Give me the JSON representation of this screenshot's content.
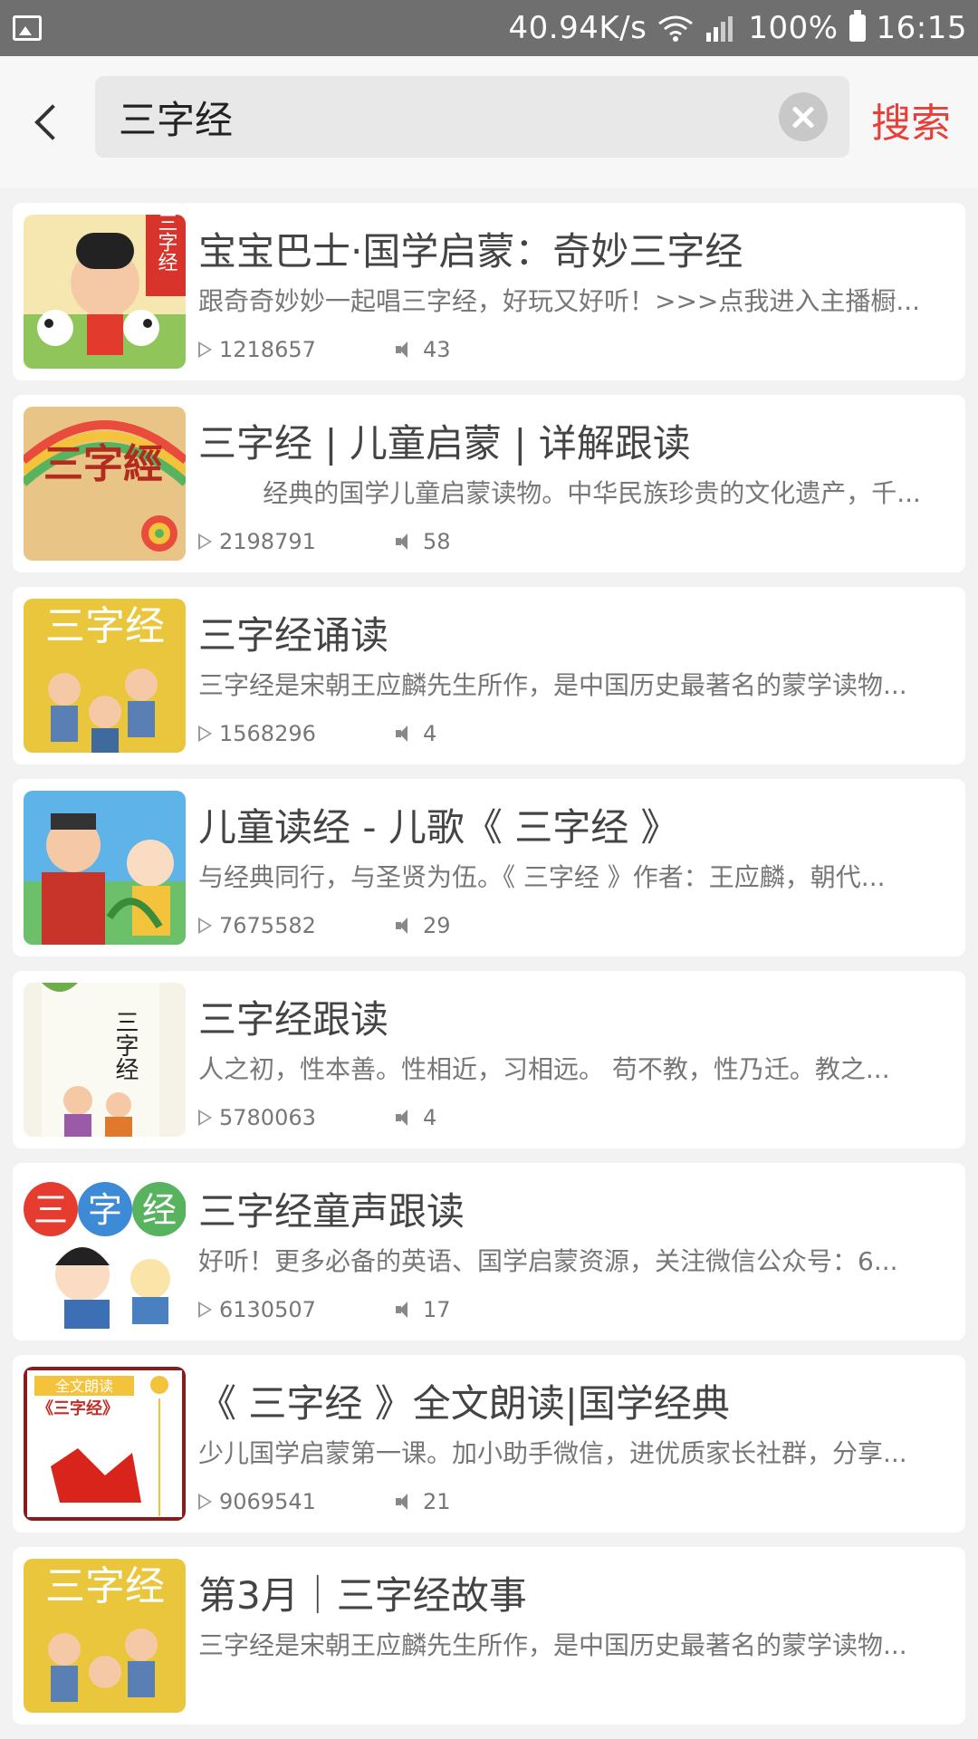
{
  "statusbar": {
    "speed": "40.94K/s",
    "network": "4G",
    "battery": "100%",
    "time": "16:15"
  },
  "header": {
    "query": "三字经",
    "search_label": "搜索"
  },
  "results": [
    {
      "title": "宝宝巴士·国学启蒙：奇妙三字经",
      "desc": "跟奇奇妙妙一起唱三字经，好玩又好听！>>>点我进入主播橱...",
      "plays": "1218657",
      "episodes": "43",
      "thumb_color": "#f7c85e"
    },
    {
      "title": "三字经 | 儿童启蒙 | 详解跟读",
      "desc": "        经典的国学儿童启蒙读物。中华民族珍贵的文化遗产，千...",
      "plays": "2198791",
      "episodes": "58",
      "thumb_color": "#e3b26a"
    },
    {
      "title": "三字经诵读",
      "desc": "三字经是宋朝王应麟先生所作，是中国历史最著名的蒙学读物...",
      "plays": "1568296",
      "episodes": "4",
      "thumb_color": "#e9c63c"
    },
    {
      "title": "儿童读经 - 儿歌《 三字经 》",
      "desc": "与经典同行，与圣贤为伍。《 三字经 》作者：王应麟，朝代...",
      "plays": "7675582",
      "episodes": "29",
      "thumb_color": "#5eb4e8"
    },
    {
      "title": "三字经跟读",
      "desc": "人之初，性本善。性相近，习相远。 苟不教，性乃迁。教之...",
      "plays": "5780063",
      "episodes": "4",
      "thumb_color": "#f5f3e8"
    },
    {
      "title": "三字经童声跟读",
      "desc": "好听！更多必备的英语、国学启蒙资源，关注微信公众号：6...",
      "plays": "6130507",
      "episodes": "17",
      "thumb_color": "#ffffff"
    },
    {
      "title": "《 三字经 》全文朗读|国学经典",
      "desc": "少儿国学启蒙第一课。加小助手微信，进优质家长社群，分享...",
      "plays": "9069541",
      "episodes": "21",
      "thumb_color": "#ffffff"
    },
    {
      "title": "第3月｜三字经故事",
      "desc": "三字经是宋朝王应麟先生所作，是中国历史最著名的蒙学读物...",
      "plays": "",
      "episodes": "",
      "thumb_color": "#e9c63c"
    }
  ],
  "thumb_texts": {
    "t1": "三字经",
    "t2": "三字經",
    "t3": "三字经",
    "t5": "三字经",
    "t6a": "三",
    "t6b": "字",
    "t6c": "经",
    "t7a": "全文朗读",
    "t7b": "《三字经》",
    "t8": "三字经"
  },
  "colors": {
    "accent": "#e5413a",
    "statusbar": "#6f6f6f"
  }
}
